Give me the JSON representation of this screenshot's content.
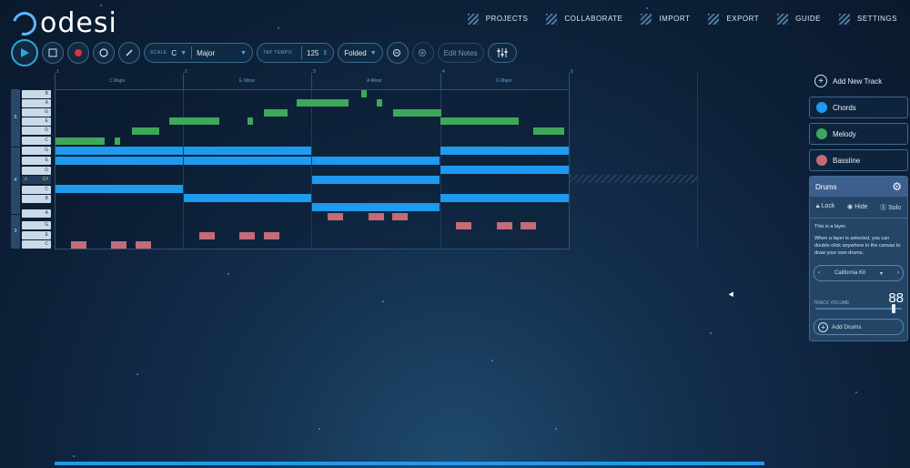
{
  "app": {
    "name": "odesi"
  },
  "nav": [
    "PROJECTS",
    "COLLABORATE",
    "IMPORT",
    "EXPORT",
    "GUIDE",
    "SETTINGS"
  ],
  "toolbar": {
    "scale_label": "SCALE",
    "scale_key": "C",
    "scale_mode": "Major",
    "tap_tempo_label": "TAP TEMPO",
    "tempo": "125",
    "view_mode": "Folded",
    "edit_notes": "Edit Notes"
  },
  "roll": {
    "bars": [
      {
        "number": "1",
        "chord": "C Major"
      },
      {
        "number": "2",
        "chord": "E Minor"
      },
      {
        "number": "3",
        "chord": "A Minor"
      },
      {
        "number": "4",
        "chord": "G Major"
      },
      {
        "number": "5",
        "chord": ""
      }
    ],
    "keys": [
      "B",
      "A",
      "G",
      "E",
      "D",
      "C",
      "G",
      "E",
      "D",
      "C#",
      "C",
      "B",
      "A",
      "G",
      "E",
      "C"
    ],
    "octaves": [
      "5",
      "4",
      "3"
    ]
  },
  "panel": {
    "add_track": "Add New Track",
    "tracks": [
      {
        "name": "Chords",
        "color": "#1e9aee"
      },
      {
        "name": "Melody",
        "color": "#3ea85a"
      },
      {
        "name": "Bassline",
        "color": "#c36b78"
      }
    ],
    "drums": {
      "title": "Drums",
      "lock": "Lock",
      "hide": "Hide",
      "solo": "Solo",
      "info1": "This is a layer.",
      "info2": "When a layer is selected, you can double-click anywhere in the canvas to draw your own drums.",
      "kit": "California Kit",
      "volume_label": "TRACK VOLUME",
      "volume": "88",
      "volume_level": 0.88,
      "add_drums": "Add Drums"
    }
  },
  "colors": {
    "chords": "#1e9aee",
    "melody": "#3ea85a",
    "bass": "#c36b78",
    "accent": "#2fa7d8"
  }
}
